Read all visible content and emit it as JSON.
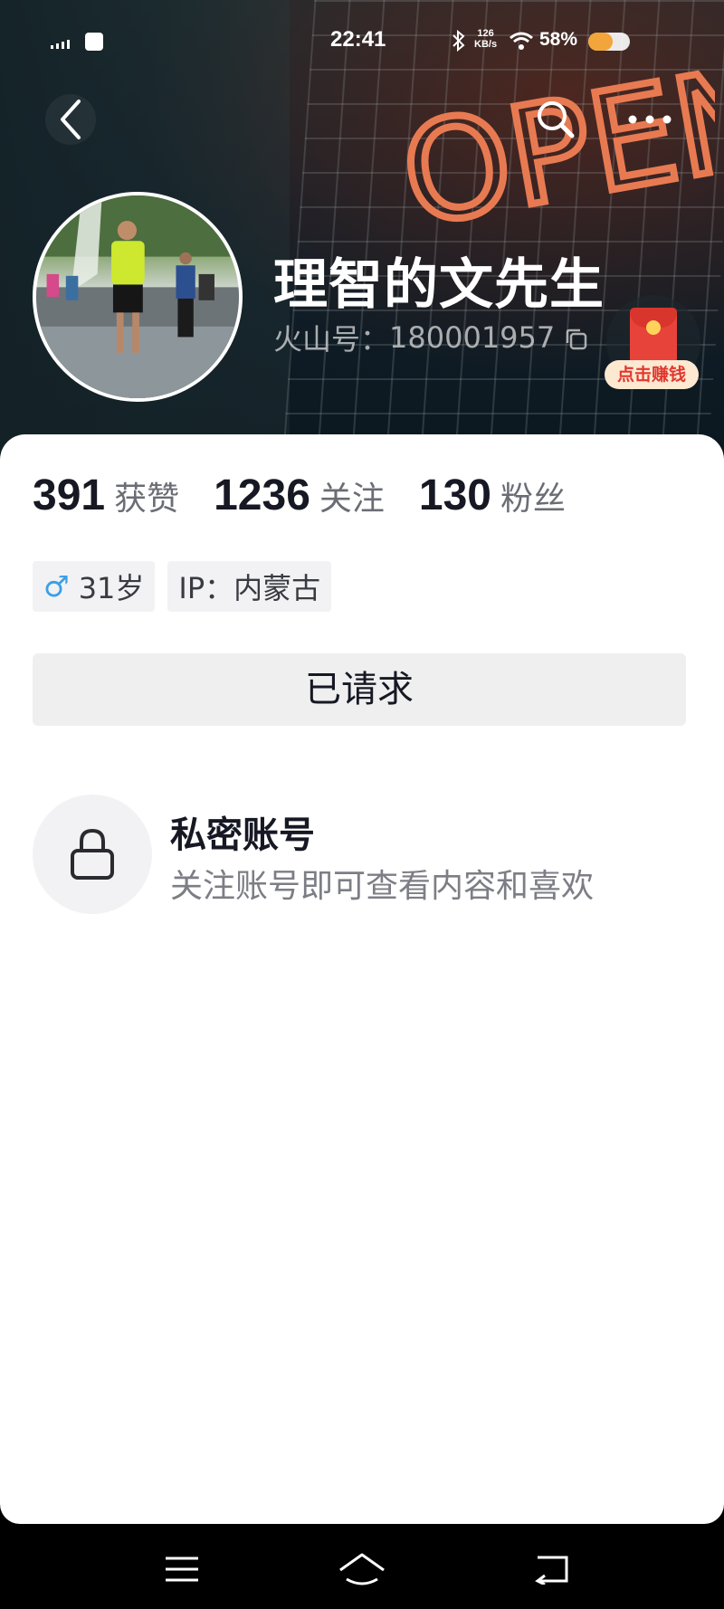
{
  "status_bar": {
    "time": "22:41",
    "net_speed_value": "126",
    "net_speed_unit": "KB/s",
    "battery_text": "58%",
    "battery_level": 0.58
  },
  "profile": {
    "username": "理智的文先生",
    "id_label": "火山号：",
    "id_value": "180001957",
    "cover_sign_text": "OPEN"
  },
  "reward": {
    "label": "点击赚钱"
  },
  "stats": [
    {
      "value": "391",
      "label": "获赞"
    },
    {
      "value": "1236",
      "label": "关注"
    },
    {
      "value": "130",
      "label": "粉丝"
    }
  ],
  "tags": {
    "gender_symbol": "♂",
    "age": "31岁",
    "ip": "IP：内蒙古"
  },
  "request_button": "已请求",
  "private_notice": {
    "title": "私密账号",
    "description": "关注账号即可查看内容和喜欢"
  },
  "colors": {
    "accent_male": "#3aa0e6",
    "reward_red": "#e8433a",
    "battery": "#f2a53a"
  }
}
